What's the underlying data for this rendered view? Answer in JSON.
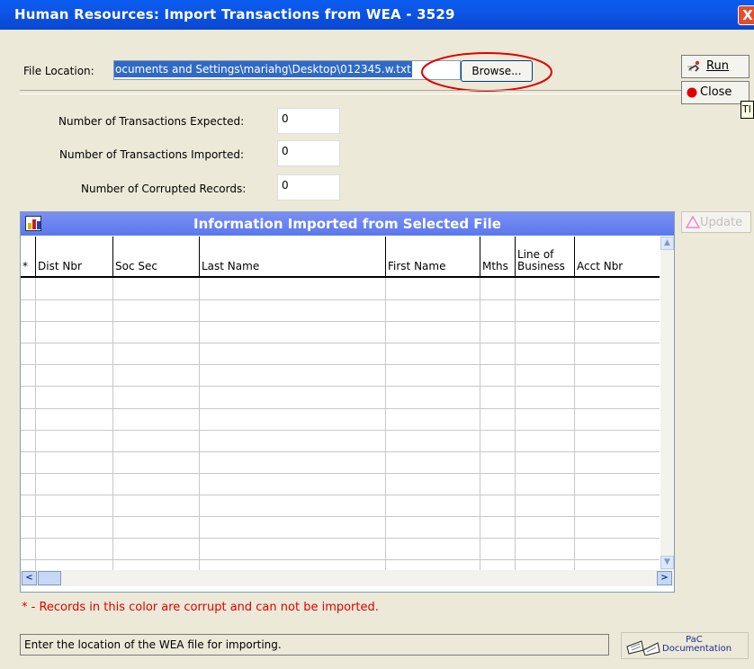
{
  "window": {
    "title": "Human Resources: Import Transactions from WEA - 3529",
    "close_glyph": "X"
  },
  "file_location": {
    "label": "File Location:",
    "value": "ocuments and Settings\\mariahg\\Desktop\\012345.w.txt",
    "browse_label": "Browse..."
  },
  "actions": {
    "run_label": "Run",
    "close_label": "Close",
    "update_label": "Update",
    "tooltip_fragment": "Tl"
  },
  "counts": {
    "expected_label": "Number of Transactions Expected:",
    "expected_value": "0",
    "imported_label": "Number of Transactions Imported:",
    "imported_value": "0",
    "corrupted_label": "Number of Corrupted Records:",
    "corrupted_value": "0"
  },
  "grid": {
    "title": "Information Imported from Selected File",
    "columns": [
      "*",
      "Dist Nbr",
      "Soc Sec",
      "Last Name",
      "First Name",
      "Mths",
      "Line of\nBusiness",
      "Acct Nbr"
    ],
    "rows": []
  },
  "footer": {
    "corrupt_note": "* - Records in this color are corrupt and can not be imported.",
    "status": "Enter the location of the WEA file for importing.",
    "pac_line1": "PaC",
    "pac_line2": "Documentation"
  },
  "colors": {
    "title_bar": "#0a5cf0",
    "grid_header": "#6a84f0",
    "selection": "#316ac5",
    "warning_text": "#e00000",
    "annotation_circle": "#e00000"
  },
  "icons": {
    "run": "run-icon",
    "close": "stop-icon",
    "update": "update-icon",
    "grid": "chart-icon",
    "pac": "book-icon"
  }
}
